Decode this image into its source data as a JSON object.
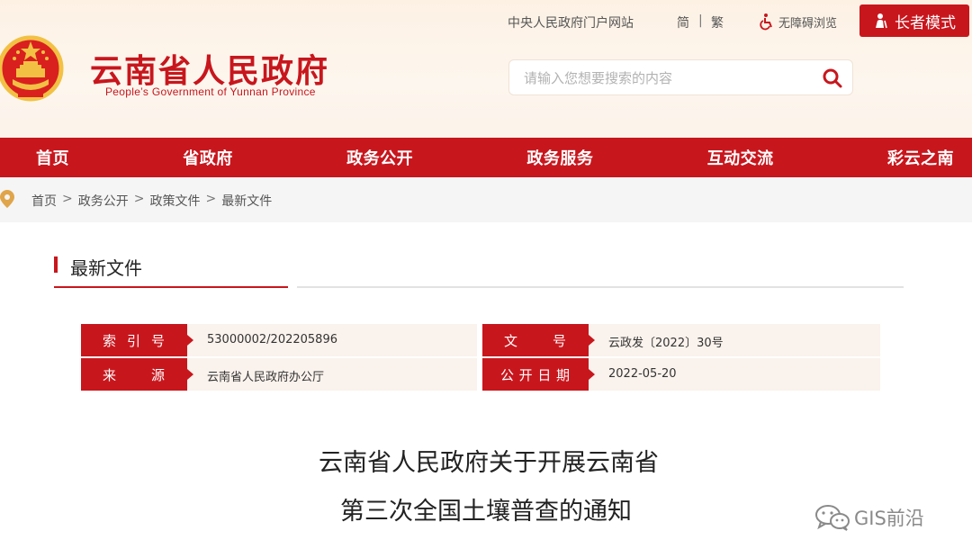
{
  "header": {
    "site_name": "云南省人民政府",
    "site_name_en": "People’s Government of Yunnan Province",
    "emblem_icon": "national-emblem-icon",
    "top_links": {
      "portal": "中央人民政府门户网站",
      "simplified": "简",
      "separator": "|",
      "traditional": "繁",
      "accessibility": "无障碍浏览"
    },
    "elder_mode": "长者模式",
    "search": {
      "placeholder": "请输入您想要搜索的内容",
      "value": ""
    }
  },
  "nav": {
    "items": [
      {
        "label": "首页"
      },
      {
        "label": "省政府"
      },
      {
        "label": "政务公开"
      },
      {
        "label": "政务服务"
      },
      {
        "label": "互动交流"
      },
      {
        "label": "彩云之南"
      }
    ]
  },
  "breadcrumb": {
    "items": [
      "首页",
      "政务公开",
      "政策文件",
      "最新文件"
    ],
    "separator": ">"
  },
  "section": {
    "title": "最新文件"
  },
  "meta": {
    "index_label": [
      "索",
      "引",
      "号"
    ],
    "index_value": "53000002/202205896",
    "doc_label": [
      "文",
      "号"
    ],
    "doc_value": "云政发〔2022〕30号",
    "source_label": [
      "来",
      "源"
    ],
    "source_value": "云南省人民政府办公厅",
    "date_label": [
      "公",
      "开",
      "日",
      "期"
    ],
    "date_value": "2022-05-20"
  },
  "article": {
    "title_line1": "云南省人民政府关于开展云南省",
    "title_line2": "第三次全国土壤普查的通知"
  },
  "watermark": {
    "text": "GIS前沿",
    "icon": "wechat-icon"
  },
  "colors": {
    "brand_red": "#c8161d",
    "header_bg": "#fdf1e4",
    "meta_bg": "#faf2ec"
  }
}
